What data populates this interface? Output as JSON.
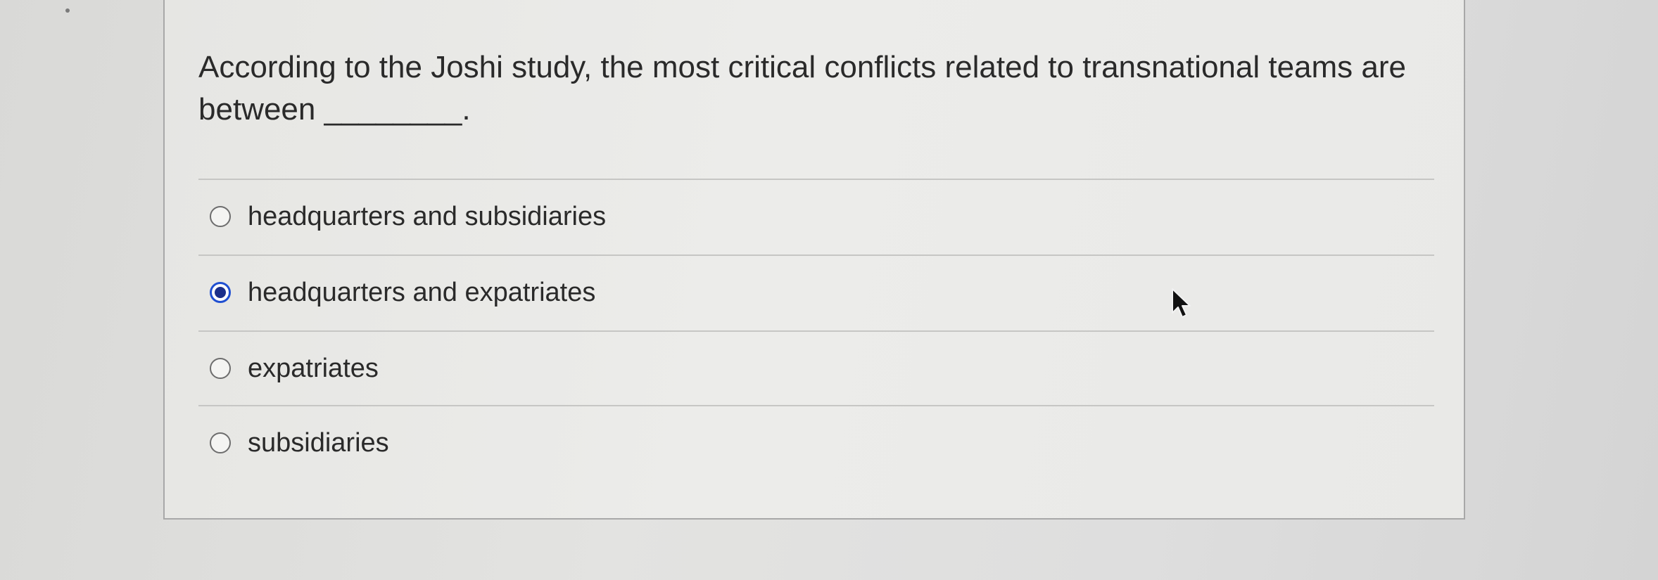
{
  "question": {
    "text": "According to the Joshi study, the most critical conflicts related to transnational teams are between ________."
  },
  "options": [
    {
      "label": "headquarters and subsidiaries",
      "selected": false
    },
    {
      "label": "headquarters and expatriates",
      "selected": true
    },
    {
      "label": "expatriates",
      "selected": false
    },
    {
      "label": "subsidiaries",
      "selected": false
    }
  ],
  "colors": {
    "selected_radio_border": "#1f4fd1",
    "selected_radio_dot": "#1b2f8a",
    "text": "#2a2a2a"
  },
  "icons": {
    "pointer": "mouse-pointer-icon"
  }
}
